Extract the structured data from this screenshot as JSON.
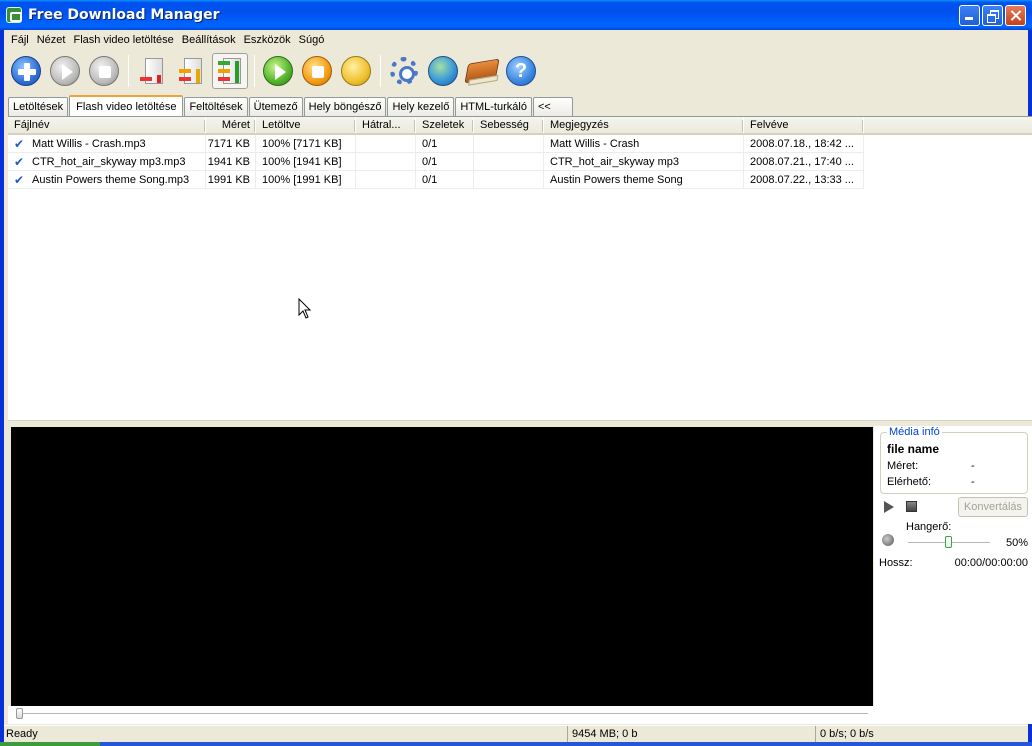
{
  "window": {
    "title": "Free Download Manager"
  },
  "menu": [
    "Fájl",
    "Nézet",
    "Flash video letöltése",
    "Beállítások",
    "Eszközök",
    "Súgó"
  ],
  "toolbar": {
    "buttons": [
      {
        "name": "add-download",
        "icon": "plus-circle-icon"
      },
      {
        "name": "start",
        "icon": "play-circle-icon"
      },
      {
        "name": "stop",
        "icon": "stop-circle-icon"
      },
      {
        "name": "traffic-low",
        "icon": "traffic-low-icon"
      },
      {
        "name": "traffic-medium",
        "icon": "traffic-medium-icon"
      },
      {
        "name": "traffic-high",
        "icon": "traffic-high-icon",
        "active": true
      },
      {
        "name": "start-all",
        "icon": "start-all-icon"
      },
      {
        "name": "stop-all",
        "icon": "stop-all-icon"
      },
      {
        "name": "schedule",
        "icon": "schedule-icon"
      },
      {
        "name": "settings",
        "icon": "gear-icon"
      },
      {
        "name": "dialup",
        "icon": "globe-phone-icon"
      },
      {
        "name": "site-explorer",
        "icon": "book-icon"
      },
      {
        "name": "help",
        "icon": "help-icon",
        "label": "?"
      }
    ]
  },
  "tabs": [
    {
      "label": "Letöltések",
      "active": false
    },
    {
      "label": "Flash video letöltése",
      "active": true
    },
    {
      "label": "Feltöltések",
      "active": false
    },
    {
      "label": "Ütemező",
      "active": false
    },
    {
      "label": "Hely böngésző",
      "active": false
    },
    {
      "label": "Hely kezelő",
      "active": false
    },
    {
      "label": "HTML-turkáló",
      "active": false
    },
    {
      "label": "<<",
      "active": false
    }
  ],
  "table": {
    "columns": [
      "Fájlnév",
      "Méret",
      "Letöltve",
      "Hátral...",
      "Szeletek",
      "Sebesség",
      "Megjegyzés",
      "Felvéve"
    ],
    "rows": [
      {
        "name": "Matt Willis - Crash.mp3",
        "size": "7171 KB",
        "downloaded": "100% [7171 KB]",
        "left": "",
        "parts": "0/1",
        "speed": "",
        "comment": "Matt Willis - Crash",
        "added": "2008.07.18., 18:42 ..."
      },
      {
        "name": "CTR_hot_air_skyway mp3.mp3",
        "size": "1941 KB",
        "downloaded": "100% [1941 KB]",
        "left": "",
        "parts": "0/1",
        "speed": "",
        "comment": "CTR_hot_air_skyway mp3",
        "added": "2008.07.21., 17:40 ..."
      },
      {
        "name": "Austin Powers theme Song.mp3",
        "size": "1991 KB",
        "downloaded": "100% [1991 KB]",
        "left": "",
        "parts": "0/1",
        "speed": "",
        "comment": "Austin Powers theme Song",
        "added": "2008.07.22., 13:33 ..."
      }
    ]
  },
  "media": {
    "group_title": "Média infó",
    "file_name": "file name",
    "size_label": "Méret:",
    "size_value": "-",
    "available_label": "Elérhető:",
    "available_value": "-",
    "convert_label": "Konvertálás",
    "volume_label": "Hangerő:",
    "volume_value": "50%",
    "volume_fraction": 0.5,
    "length_label": "Hossz:",
    "length_value": "00:00/00:00:00",
    "seek_fraction": 0.0
  },
  "status": {
    "text": "Ready",
    "traffic": "9454 MB; 0 b",
    "speed": "0 b/s; 0 b/s"
  }
}
